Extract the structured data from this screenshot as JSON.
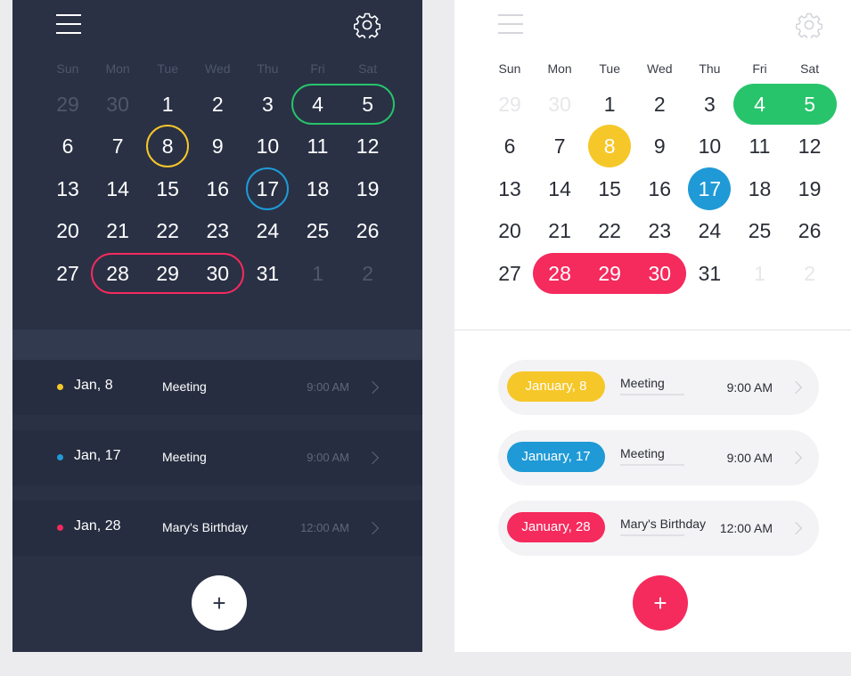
{
  "weekdays": [
    "Sun",
    "Mon",
    "Tue",
    "Wed",
    "Thu",
    "Fri",
    "Sat"
  ],
  "calendar": [
    [
      {
        "d": "29",
        "out": true
      },
      {
        "d": "30",
        "out": true
      },
      {
        "d": "1"
      },
      {
        "d": "2"
      },
      {
        "d": "3"
      },
      {
        "d": "4"
      },
      {
        "d": "5"
      }
    ],
    [
      {
        "d": "6"
      },
      {
        "d": "7"
      },
      {
        "d": "8"
      },
      {
        "d": "9"
      },
      {
        "d": "10"
      },
      {
        "d": "11"
      },
      {
        "d": "12"
      }
    ],
    [
      {
        "d": "13"
      },
      {
        "d": "14"
      },
      {
        "d": "15"
      },
      {
        "d": "16"
      },
      {
        "d": "17"
      },
      {
        "d": "18"
      },
      {
        "d": "19"
      }
    ],
    [
      {
        "d": "20"
      },
      {
        "d": "21"
      },
      {
        "d": "22"
      },
      {
        "d": "23"
      },
      {
        "d": "24"
      },
      {
        "d": "25"
      },
      {
        "d": "26"
      }
    ],
    [
      {
        "d": "27"
      },
      {
        "d": "28"
      },
      {
        "d": "29"
      },
      {
        "d": "30"
      },
      {
        "d": "31"
      },
      {
        "d": "1",
        "out": true
      },
      {
        "d": "2",
        "out": true
      }
    ]
  ],
  "highlights": [
    {
      "kind": "range",
      "row": 0,
      "start": 5,
      "end": 6,
      "color": "#27c46b"
    },
    {
      "kind": "single",
      "row": 1,
      "col": 2,
      "color": "#f6c729"
    },
    {
      "kind": "single",
      "row": 2,
      "col": 4,
      "color": "#1f9ad6"
    },
    {
      "kind": "range",
      "row": 4,
      "start": 1,
      "end": 3,
      "color": "#f52a5d"
    }
  ],
  "dark": {
    "events": [
      {
        "date": "Jan, 8",
        "title": "Meeting",
        "time": "9:00 AM",
        "color": "#f6c729"
      },
      {
        "date": "Jan, 17",
        "title": "Meeting",
        "time": "9:00 AM",
        "color": "#1f9ad6"
      },
      {
        "date": "Jan, 28",
        "title": "Mary's Birthday",
        "time": "12:00 AM",
        "color": "#f52a5d"
      }
    ],
    "add_label": "+"
  },
  "light": {
    "events": [
      {
        "date": "January, 8",
        "title": "Meeting",
        "time": "9:00 AM",
        "color": "#f6c729"
      },
      {
        "date": "January, 17",
        "title": "Meeting",
        "time": "9:00 AM",
        "color": "#1f9ad6"
      },
      {
        "date": "January, 28",
        "title": "Mary's Birthday",
        "time": "12:00 AM",
        "color": "#f52a5d"
      }
    ],
    "add_label": "+"
  },
  "icons": {
    "menu": "hamburger-menu-icon",
    "settings": "gear-icon",
    "chevron": "chevron-right-icon",
    "add": "plus-icon"
  },
  "colors": {
    "dark_bg": "#2a3145",
    "light_bg": "#ffffff",
    "page_bg": "#ececef"
  }
}
